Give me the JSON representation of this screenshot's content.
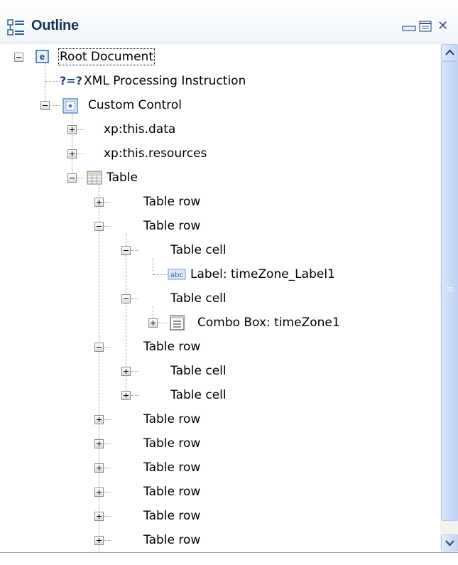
{
  "header": {
    "title": "Outline",
    "icons": [
      "outline-view-icon",
      "minimize-icon",
      "maximize-icon",
      "close-icon"
    ],
    "close_glyph": "✕"
  },
  "tree": {
    "items": [
      {
        "label": "Root Document",
        "icon": "element-e-icon",
        "expanded": true,
        "selected": true
      },
      {
        "label": "XML Processing Instruction",
        "icon": "processing-instruction-icon",
        "icon_text": "?=?"
      },
      {
        "label": "Custom Control",
        "icon": "custom-control-icon",
        "expanded": true
      },
      {
        "label": "xp:this.data",
        "expanded": false
      },
      {
        "label": "xp:this.resources",
        "expanded": false
      },
      {
        "label": "Table",
        "icon": "table-icon",
        "expanded": true
      },
      {
        "label": "Table row",
        "expanded": false
      },
      {
        "label": "Table row",
        "expanded": true
      },
      {
        "label": "Table cell",
        "expanded": true
      },
      {
        "label": "Label: timeZone_Label1",
        "icon": "label-icon",
        "icon_text": "abc"
      },
      {
        "label": "Table cell",
        "expanded": true
      },
      {
        "label": "Combo Box: timeZone1",
        "icon": "combo-box-icon",
        "expanded": false
      },
      {
        "label": "Table row",
        "expanded": true
      },
      {
        "label": "Table cell",
        "expanded": false
      },
      {
        "label": "Table cell",
        "expanded": false
      },
      {
        "label": "Table row",
        "expanded": false
      },
      {
        "label": "Table row",
        "expanded": false
      },
      {
        "label": "Table row",
        "expanded": false
      },
      {
        "label": "Table row",
        "expanded": false
      },
      {
        "label": "Table row",
        "expanded": false
      },
      {
        "label": "Table row",
        "expanded": false
      }
    ]
  },
  "colors": {
    "title": "#16325c",
    "header_bg": "#f2f6fb",
    "scroll_thumb": "#c4d4f4"
  }
}
